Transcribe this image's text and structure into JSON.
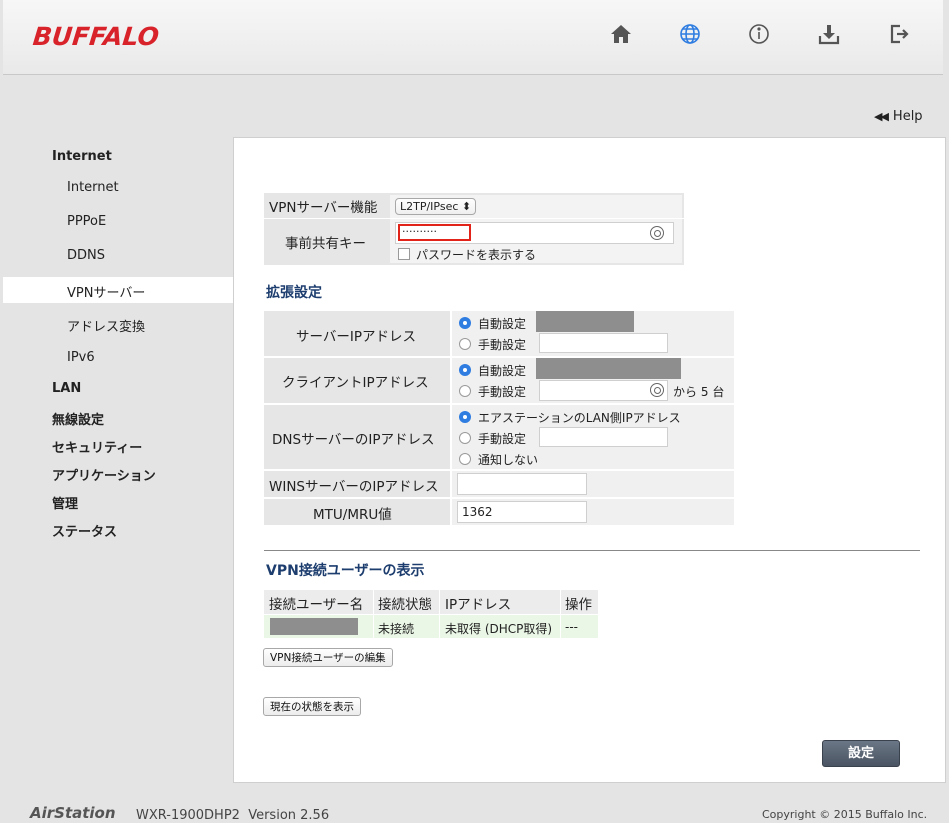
{
  "header": {
    "logo": "BUFFALO",
    "icons": [
      "home-icon",
      "globe-icon",
      "info-icon",
      "download-icon",
      "logout-icon"
    ],
    "help_label": "Help"
  },
  "sidebar": {
    "items": [
      {
        "label": "Internet",
        "level": "top"
      },
      {
        "label": "Internet",
        "level": "sub"
      },
      {
        "label": "PPPoE",
        "level": "sub"
      },
      {
        "label": "DDNS",
        "level": "sub"
      },
      {
        "label": "VPNサーバー",
        "level": "sub",
        "active": true
      },
      {
        "label": "アドレス変換",
        "level": "sub"
      },
      {
        "label": "IPv6",
        "level": "sub"
      },
      {
        "label": "LAN",
        "level": "top"
      },
      {
        "label": "無線設定",
        "level": "top"
      },
      {
        "label": "セキュリティー",
        "level": "top"
      },
      {
        "label": "アプリケーション",
        "level": "top"
      },
      {
        "label": "管理",
        "level": "top"
      },
      {
        "label": "ステータス",
        "level": "top"
      }
    ]
  },
  "vpn": {
    "server_function_label": "VPNサーバー機能",
    "server_function_value": "L2TP/IPsec",
    "psk_label": "事前共有キー",
    "psk_value": "··········",
    "show_password_label": "パスワードを表示する"
  },
  "advanced": {
    "title": "拡張設定",
    "server_ip_label": "サーバーIPアドレス",
    "client_ip_label": "クライアントIPアドレス",
    "dns_label": "DNSサーバーのIPアドレス",
    "wins_label": "WINSサーバーのIPアドレス",
    "mtu_label": "MTU/MRU値",
    "mtu_value": "1362",
    "auto": "自動設定",
    "manual": "手動設定",
    "dns_station": "エアステーションのLAN側IPアドレス",
    "dns_none": "通知しない",
    "client_from": "から",
    "client_count": "5",
    "client_unit": "台"
  },
  "users": {
    "title": "VPN接続ユーザーの表示",
    "headers": [
      "接続ユーザー名",
      "接続状態",
      "IPアドレス",
      "操作"
    ],
    "row": {
      "status": "未接続",
      "ip": "未取得 (DHCP取得)",
      "op": "---"
    },
    "edit_button": "VPN接続ユーザーの編集"
  },
  "show_status_button": "現在の状態を表示",
  "submit_button": "設定",
  "footer": {
    "brand": "AirStation",
    "model": "WXR-1900DHP2",
    "version": "Version 2.56",
    "copyright": "Copyright © 2015 Buffalo Inc."
  },
  "colors": {
    "logo": "#d8232a",
    "accent_blue": "#2f7de1",
    "section_title": "#1c3d6e",
    "label_bg": "#e6e6e6",
    "users_row_bg": "#eaf6e6"
  }
}
